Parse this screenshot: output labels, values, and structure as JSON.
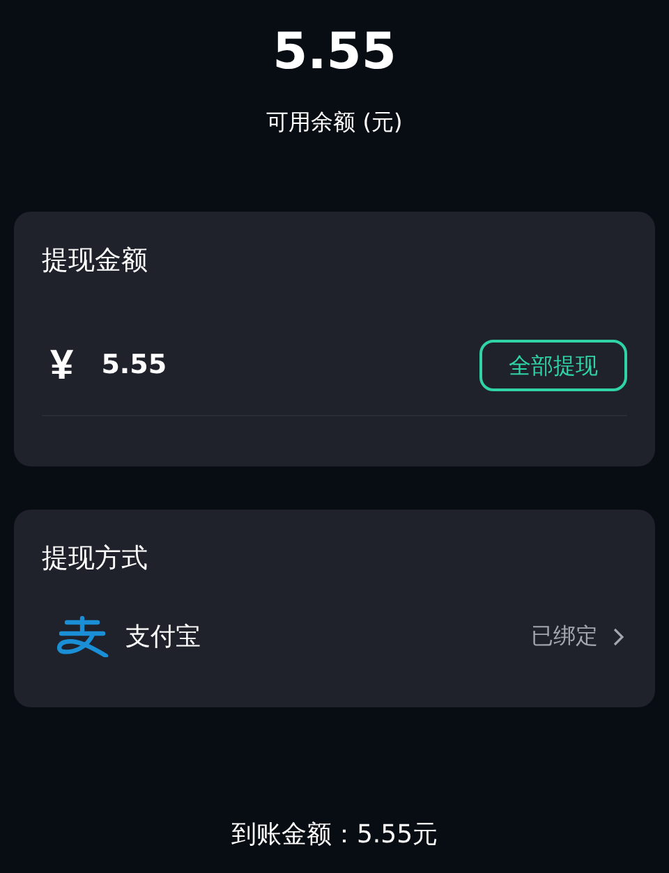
{
  "balance": {
    "amount": "5.55",
    "label": "可用余额 (元)"
  },
  "withdraw_amount": {
    "title": "提现金额",
    "currency": "¥",
    "value": "5.55",
    "button": "全部提现"
  },
  "withdraw_method": {
    "title": "提现方式",
    "method": "支付宝",
    "status": "已绑定"
  },
  "footer": {
    "text": "到账金额：5.55元"
  }
}
